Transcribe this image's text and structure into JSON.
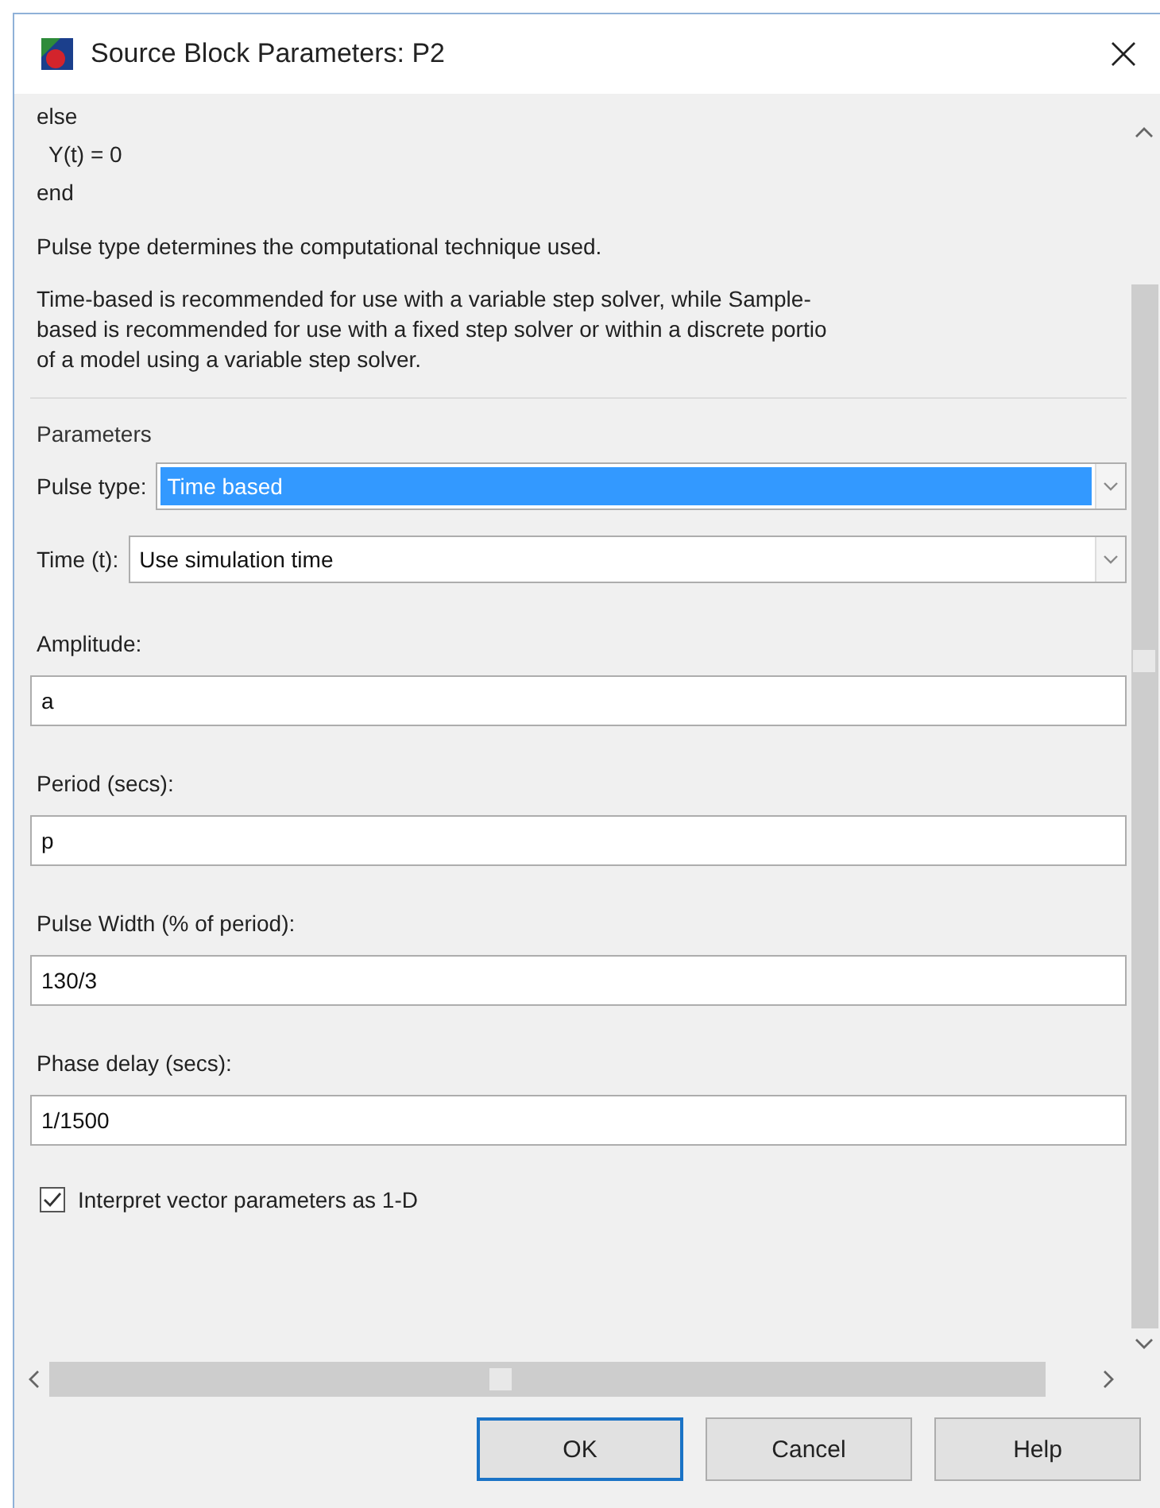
{
  "window": {
    "title": "Source Block Parameters: P2"
  },
  "description": {
    "code_lines": [
      "else",
      "  Y(t) = 0",
      "end"
    ],
    "summary": "Pulse type determines the computational technique used.",
    "paragraph_lines": [
      "Time-based is recommended for use with a variable step solver, while Sample-",
      "based is recommended for use with a fixed step solver or within a discrete portio",
      "of a model using a variable step solver."
    ]
  },
  "parameters": {
    "title": "Parameters",
    "fields": [
      {
        "kind": "select",
        "label": "Pulse type:",
        "value": "Time based",
        "highlighted": true
      },
      {
        "kind": "select",
        "label": "Time (t):",
        "value": "Use simulation time",
        "highlighted": false
      },
      {
        "kind": "text",
        "label": "Amplitude:",
        "value": "a"
      },
      {
        "kind": "text",
        "label": "Period (secs):",
        "value": "p"
      },
      {
        "kind": "text",
        "label": "Pulse Width (% of period):",
        "value": "130/3"
      },
      {
        "kind": "text",
        "label": "Phase delay (secs):",
        "value": "1/1500"
      },
      {
        "kind": "checkbox",
        "label": "Interpret vector parameters as 1-D",
        "checked": true
      }
    ]
  },
  "buttons": [
    {
      "label": "OK",
      "default": true
    },
    {
      "label": "Cancel",
      "default": false
    },
    {
      "label": "Help",
      "default": false
    }
  ]
}
